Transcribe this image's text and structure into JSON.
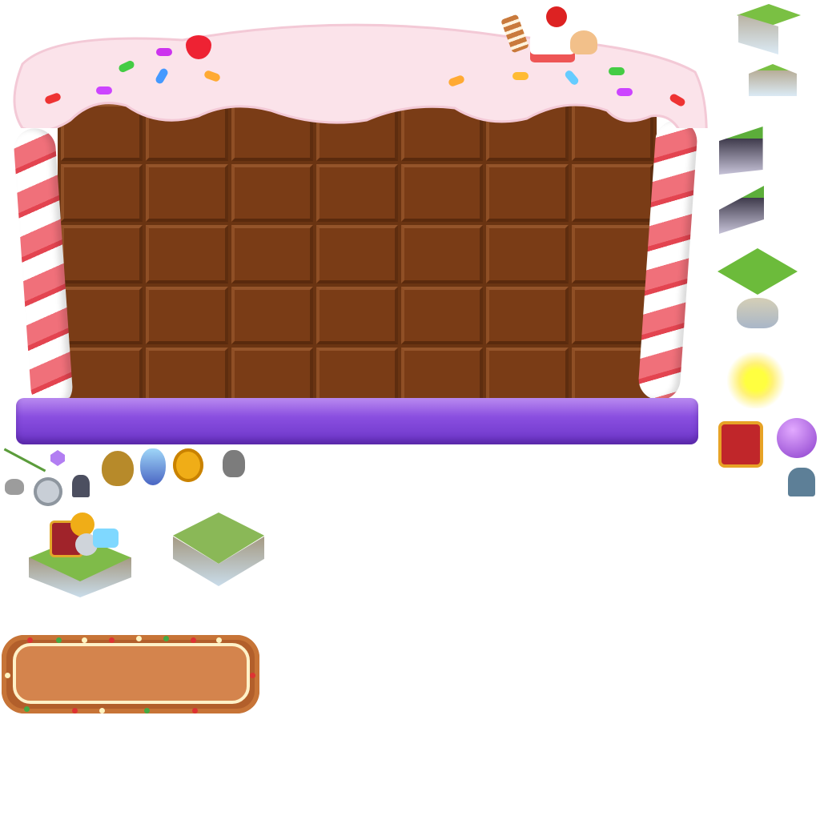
{
  "sprite_sheet": {
    "frame": {
      "colors": {
        "frosting": "#fbe3ea",
        "chocolate": "#7a3c16",
        "base": "#8a4fe0",
        "cane_red": "#e34450"
      },
      "decorations": [
        "strawberry-icon",
        "cake-slice-icon",
        "jelly-bean-icon"
      ]
    },
    "side_sprites": [
      "cliff-tile-icon",
      "cliff-tile-icon",
      "dark-cliff-tile-icon",
      "dark-cliff-tile-icon",
      "grass-tile-icon",
      "rock-tile-icon",
      "sparkle-icon",
      "treasure-chest-icon",
      "gem-bag-icon",
      "rune-stone-icon"
    ],
    "items": [
      "stick-icon",
      "gem-icon",
      "coin-bag-icon",
      "potion-icon",
      "gold-coin-icon",
      "ore-rock-icon",
      "pebble-icon",
      "silver-coin-icon",
      "rune-stone-icon"
    ],
    "islands": [
      "treasure-island-icon",
      "grass-island-icon"
    ],
    "panel": {
      "colors": {
        "bg": "#d4844d",
        "border": "#b25f2b"
      }
    }
  }
}
